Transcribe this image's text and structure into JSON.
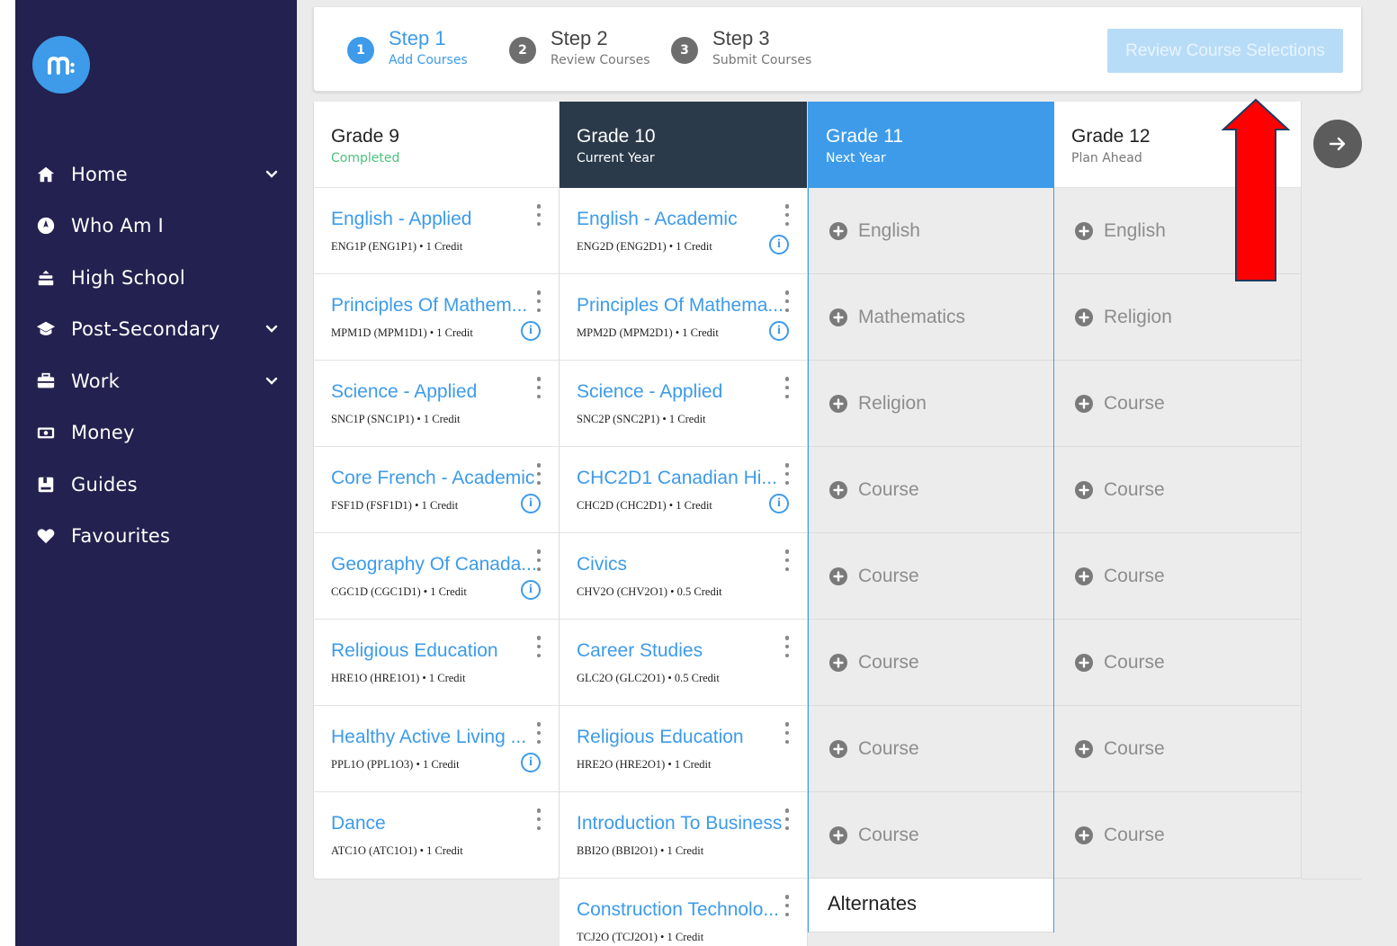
{
  "sidebar": {
    "logo_icon": "myblueprint-logo-icon",
    "items": [
      {
        "label": "Home",
        "icon": "home-icon",
        "has_chevron": true
      },
      {
        "label": "Who Am I",
        "icon": "compass-icon",
        "has_chevron": false
      },
      {
        "label": "High School",
        "icon": "school-icon",
        "has_chevron": false
      },
      {
        "label": "Post-Secondary",
        "icon": "graduation-cap-icon",
        "has_chevron": true
      },
      {
        "label": "Work",
        "icon": "briefcase-icon",
        "has_chevron": true
      },
      {
        "label": "Money",
        "icon": "money-icon",
        "has_chevron": false
      },
      {
        "label": "Guides",
        "icon": "book-icon",
        "has_chevron": false
      },
      {
        "label": "Favourites",
        "icon": "heart-icon",
        "has_chevron": false
      }
    ]
  },
  "stepper": {
    "steps": [
      {
        "number": "1",
        "title": "Step 1",
        "subtitle": "Add Courses",
        "active": true
      },
      {
        "number": "2",
        "title": "Step 2",
        "subtitle": "Review Courses",
        "active": false
      },
      {
        "number": "3",
        "title": "Step 3",
        "subtitle": "Submit Courses",
        "active": false
      }
    ],
    "review_button": "Review Course Selections"
  },
  "grades": [
    {
      "title": "Grade 9",
      "subtitle": "Completed",
      "courses": [
        {
          "name": "English - Applied",
          "code": "ENG1P (ENG1P1) • 1 Credit",
          "info": false
        },
        {
          "name": "Principles Of Mathem...",
          "code": "MPM1D (MPM1D1) • 1 Credit",
          "info": true
        },
        {
          "name": "Science - Applied",
          "code": "SNC1P (SNC1P1) • 1 Credit",
          "info": false
        },
        {
          "name": "Core French - Academic",
          "code": "FSF1D (FSF1D1) • 1 Credit",
          "info": true
        },
        {
          "name": "Geography Of Canada...",
          "code": "CGC1D (CGC1D1) • 1 Credit",
          "info": true
        },
        {
          "name": "Religious Education",
          "code": "HRE1O (HRE1O1) • 1 Credit",
          "info": false
        },
        {
          "name": "Healthy Active Living ...",
          "code": "PPL1O (PPL1O3) • 1 Credit",
          "info": true
        },
        {
          "name": "Dance",
          "code": "ATC1O (ATC1O1) • 1 Credit",
          "info": false
        }
      ]
    },
    {
      "title": "Grade 10",
      "subtitle": "Current Year",
      "courses": [
        {
          "name": "English - Academic",
          "code": "ENG2D (ENG2D1) • 1 Credit",
          "info": true
        },
        {
          "name": "Principles Of Mathema...",
          "code": "MPM2D (MPM2D1) • 1 Credit",
          "info": true
        },
        {
          "name": "Science - Applied",
          "code": "SNC2P (SNC2P1) • 1 Credit",
          "info": false
        },
        {
          "name": "CHC2D1 Canadian Hi...",
          "code": "CHC2D (CHC2D1) • 1 Credit",
          "info": true
        },
        {
          "name": "Civics",
          "code": "CHV2O (CHV2O1) • 0.5 Credit",
          "info": false
        },
        {
          "name": "Career Studies",
          "code": "GLC2O (GLC2O1) • 0.5 Credit",
          "info": false
        },
        {
          "name": "Religious Education",
          "code": "HRE2O (HRE2O1) • 1 Credit",
          "info": false
        },
        {
          "name": "Introduction To Business",
          "code": "BBI2O (BBI2O1) • 1 Credit",
          "info": false
        },
        {
          "name": "Construction Technolo...",
          "code": "TCJ2O (TCJ2O1) • 1 Credit",
          "info": false
        }
      ]
    },
    {
      "title": "Grade 11",
      "subtitle": "Next Year",
      "slots": [
        "English",
        "Mathematics",
        "Religion",
        "Course",
        "Course",
        "Course",
        "Course",
        "Course"
      ],
      "alternates_label": "Alternates"
    },
    {
      "title": "Grade 12",
      "subtitle": "Plan Ahead",
      "slots": [
        "English",
        "Religion",
        "Course",
        "Course",
        "Course",
        "Course",
        "Course",
        "Course"
      ]
    }
  ],
  "colors": {
    "sidebar_bg": "#22214f",
    "accent_blue": "#3d9be9",
    "grade10_header": "#2b3a4a",
    "completed_green": "#4cc27d",
    "annotation_red": "#ff0000"
  }
}
